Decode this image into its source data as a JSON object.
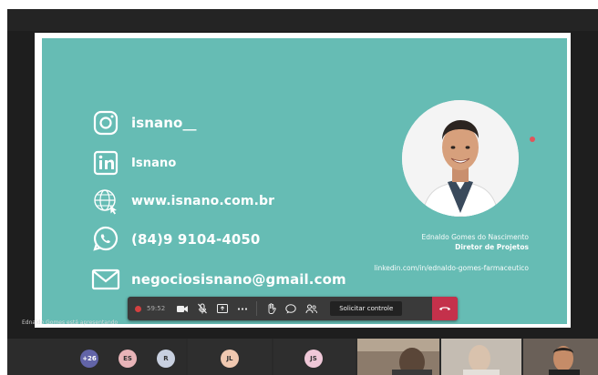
{
  "slide": {
    "contacts": [
      {
        "icon": "instagram-icon",
        "text": "isnano__"
      },
      {
        "icon": "linkedin-icon",
        "text": "Isnano"
      },
      {
        "icon": "globe-icon",
        "text": "www.isnano.com.br"
      },
      {
        "icon": "whatsapp-icon",
        "text": "(84)9 9104-4050"
      },
      {
        "icon": "mail-icon",
        "text": "negociosisnano@gmail.com"
      }
    ],
    "person": {
      "name": "Ednaldo Gomes do Nascimento",
      "role": "Diretor de Projetos",
      "linkedin": "linkedin.com/in/ednaldo-gomes-farmaceutico"
    },
    "background_color": "#66bcb4"
  },
  "control_bar": {
    "timer": "59:52",
    "request_control_label": "Solicitar controle",
    "icons": [
      "record-icon",
      "camera-icon",
      "mic-off-icon",
      "share-screen-icon",
      "more-icon",
      "raise-hand-icon",
      "chat-icon",
      "participants-icon",
      "hang-up-icon"
    ]
  },
  "caption": "Ednaldo Gomes está apresentando",
  "participants": {
    "avatars": [
      {
        "label": "+26",
        "color": "#6264a7"
      },
      {
        "label": "ES",
        "color": "#e8b4b8"
      },
      {
        "label": "R",
        "color": "#c8d0e0"
      },
      {
        "label": "JL",
        "color": "#f0c8b0"
      },
      {
        "label": "JS",
        "color": "#f0c8d8"
      }
    ]
  }
}
